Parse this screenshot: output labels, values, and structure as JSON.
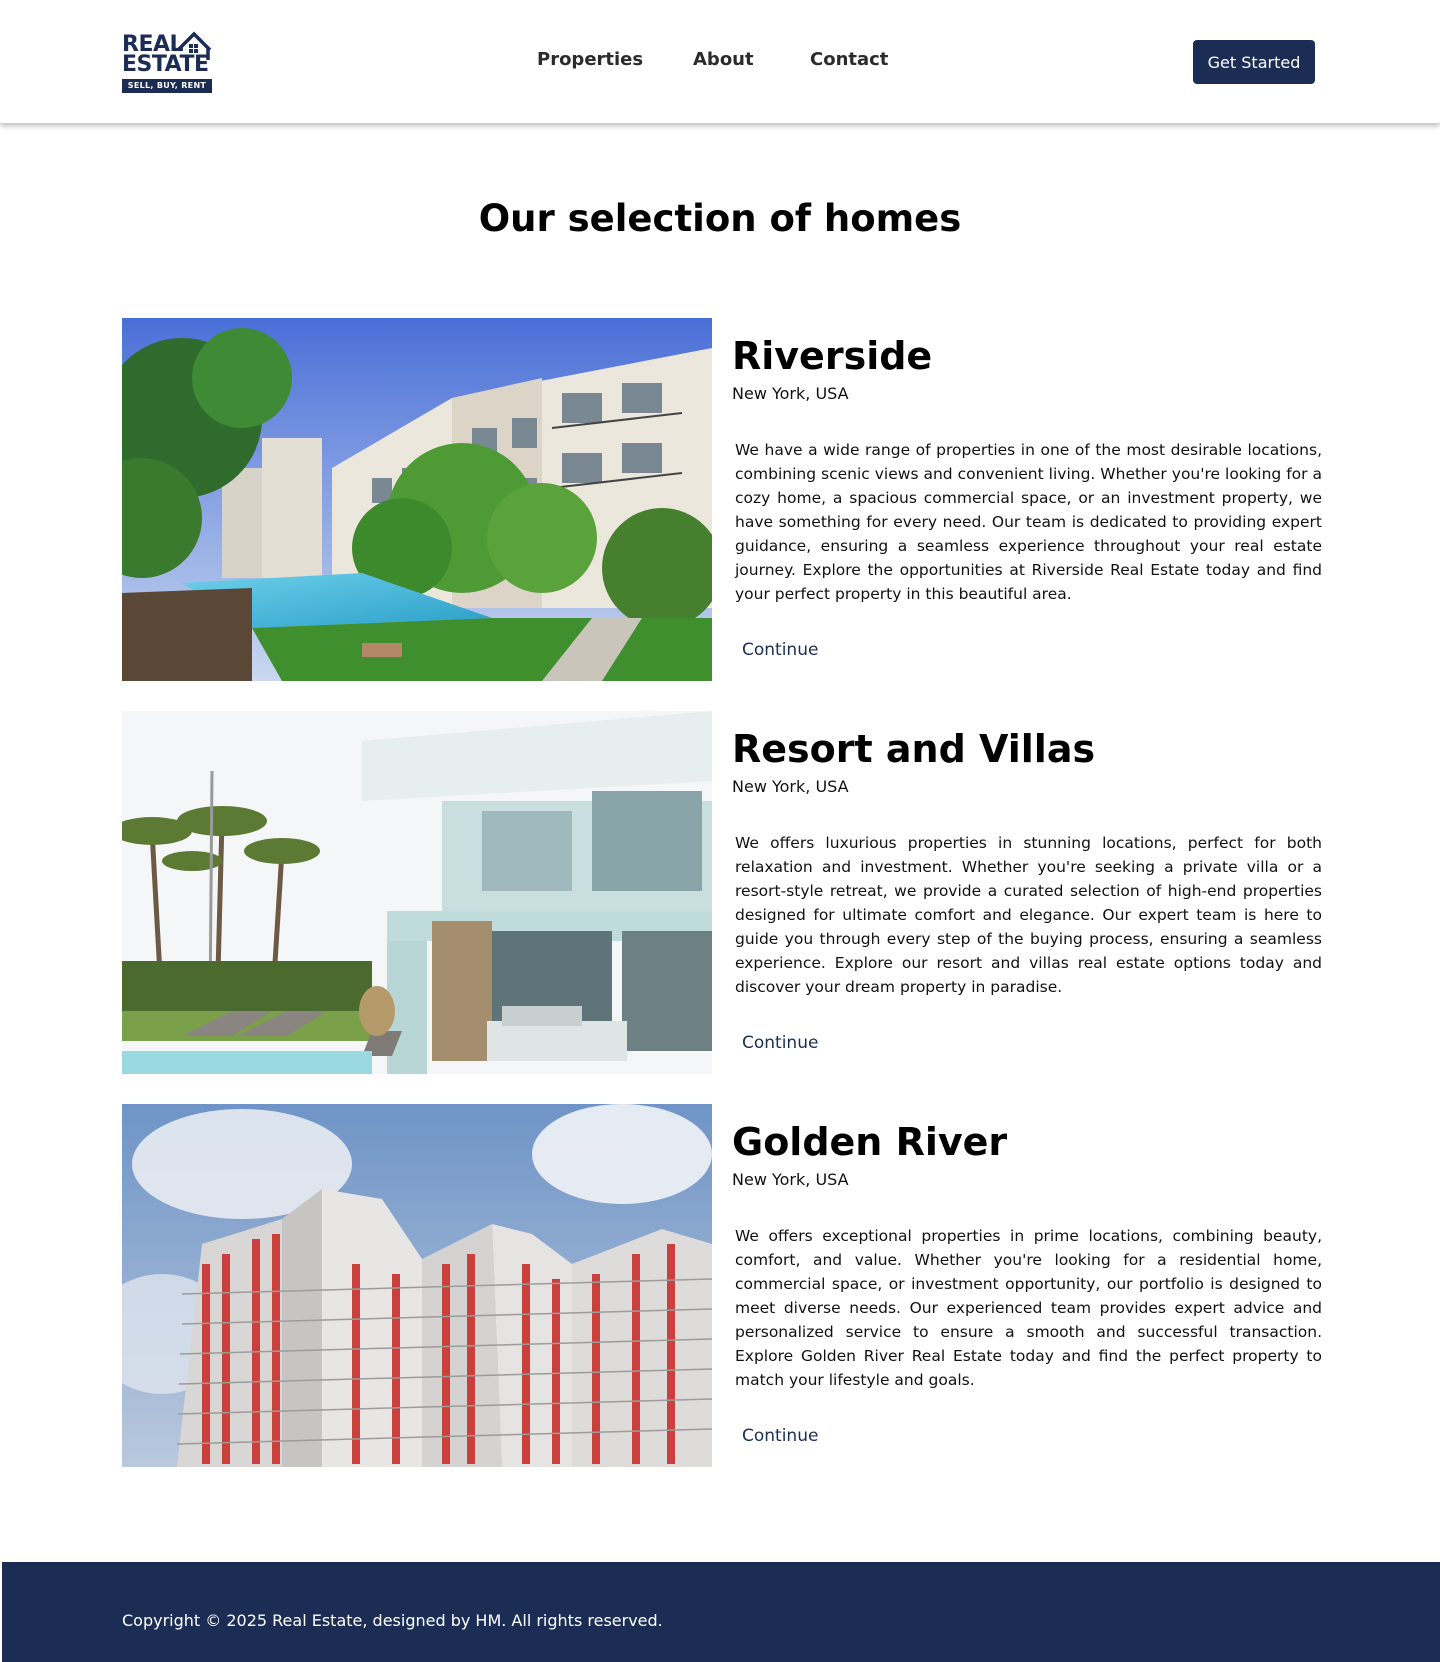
{
  "header": {
    "logo": {
      "line1": "REAL",
      "line2": "ESTATE",
      "tagline": "SELL, BUY, RENT"
    },
    "nav": [
      "Properties",
      "About",
      "Contact"
    ],
    "cta_label": "Get Started"
  },
  "main": {
    "title": "Our selection of homes",
    "properties": [
      {
        "name": "Riverside",
        "location": "New York, USA",
        "description": "We have a wide range of properties in one of the most desirable locations, combining scenic views and convenient living. Whether you're looking for a cozy home, a spacious commercial space, or an investment property, we have something for every need. Our team is dedicated to providing expert guidance, ensuring a seamless experience throughout your real estate journey. Explore the opportunities at Riverside Real Estate today and find your perfect property in this beautiful area.",
        "link_label": "Continue",
        "image": "apartment-complex-with-pool"
      },
      {
        "name": "Resort and Villas",
        "location": "New York, USA",
        "description": "We offers luxurious properties in stunning locations, perfect for both relaxation and investment. Whether you're seeking a private villa or a resort-style retreat, we provide a curated selection of high-end properties designed for ultimate comfort and elegance. Our expert team is here to guide you through every step of the buying process, ensuring a seamless experience. Explore our resort and villas real estate options today and discover your dream property in paradise.",
        "link_label": "Continue",
        "image": "modern-villa-with-palms"
      },
      {
        "name": "Golden River",
        "location": "New York, USA",
        "description": "We offers exceptional properties in prime locations, combining beauty, comfort, and value. Whether you're looking for a residential home, commercial space, or investment opportunity, our portfolio is designed to meet diverse needs. Our experienced team provides expert advice and personalized service to ensure a smooth and successful transaction. Explore Golden River Real Estate today and find the perfect property to match your lifestyle and goals.",
        "link_label": "Continue",
        "image": "high-rise-apartment-tower"
      }
    ]
  },
  "footer": {
    "copyright": "Copyright © 2025 Real Estate, designed by HM. All rights reserved."
  },
  "colors": {
    "brand": "#1b2d55",
    "background": "#ffffff",
    "text": "#000000"
  }
}
